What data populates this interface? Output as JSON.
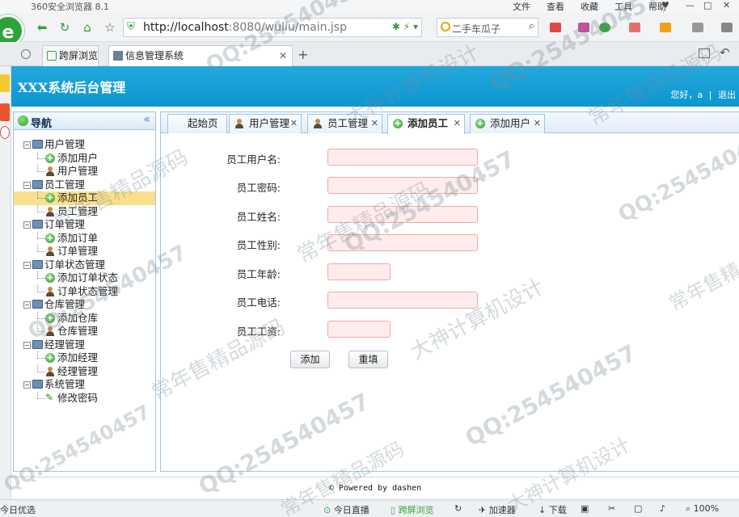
{
  "browser": {
    "app_title": "360安全浏览器 8.1",
    "menu": [
      "文件",
      "查看",
      "收藏",
      "工具",
      "帮助"
    ],
    "url_host": "http://localhost",
    "url_rest": ":8080/wuliu/main.jsp",
    "search_text": "二手车瓜子",
    "tabs": [
      {
        "label": "跨屏浏览"
      },
      {
        "label": "信息管理系统",
        "active": true
      }
    ]
  },
  "app": {
    "title": "XXX系统后台管理",
    "greeting": "您好，a",
    "logout": "退出"
  },
  "nav": {
    "title": "导航",
    "groups": [
      {
        "label": "用户管理",
        "children": [
          {
            "label": "添加用户",
            "icon": "add-icon"
          },
          {
            "label": "用户管理",
            "icon": "user-icon"
          }
        ]
      },
      {
        "label": "员工管理",
        "children": [
          {
            "label": "添加员工",
            "icon": "add-icon",
            "selected": true
          },
          {
            "label": "员工管理",
            "icon": "user-icon"
          }
        ]
      },
      {
        "label": "订单管理",
        "children": [
          {
            "label": "添加订单",
            "icon": "add-icon"
          },
          {
            "label": "订单管理",
            "icon": "user-icon"
          }
        ]
      },
      {
        "label": "订单状态管理",
        "children": [
          {
            "label": "添加订单状态",
            "icon": "add-icon"
          },
          {
            "label": "订单状态管理",
            "icon": "user-icon"
          }
        ]
      },
      {
        "label": "仓库管理",
        "children": [
          {
            "label": "添加仓库",
            "icon": "add-icon"
          },
          {
            "label": "仓库管理",
            "icon": "user-icon"
          }
        ]
      },
      {
        "label": "经理管理",
        "children": [
          {
            "label": "添加经理",
            "icon": "add-icon"
          },
          {
            "label": "经理管理",
            "icon": "user-icon"
          }
        ]
      },
      {
        "label": "系统管理",
        "children": [
          {
            "label": "修改密码",
            "icon": "pencil-icon"
          }
        ]
      }
    ]
  },
  "content_tabs": [
    {
      "label": "起始页",
      "icon": "",
      "closable": false
    },
    {
      "label": "用户管理",
      "icon": "user-icon",
      "closable": true
    },
    {
      "label": "员工管理",
      "icon": "user-icon",
      "closable": true
    },
    {
      "label": "添加员工",
      "icon": "add-icon",
      "closable": true,
      "active": true
    },
    {
      "label": "添加用户",
      "icon": "add-icon",
      "closable": true
    }
  ],
  "form": {
    "fields": [
      {
        "label": "员工用户名:",
        "value": "",
        "size": "long"
      },
      {
        "label": "员工密码:",
        "value": "",
        "size": "long"
      },
      {
        "label": "员工姓名:",
        "value": "",
        "size": "long"
      },
      {
        "label": "员工性别:",
        "value": "",
        "size": "long"
      },
      {
        "label": "员工年龄:",
        "value": "",
        "size": "short"
      },
      {
        "label": "员工电话:",
        "value": "",
        "size": "long"
      },
      {
        "label": "员工工资:",
        "value": "",
        "size": "short"
      }
    ],
    "submit_label": "添加",
    "reset_label": "重填"
  },
  "footer": {
    "powered": "© Powered by dashen"
  },
  "statusbar": {
    "left": "今日优选",
    "live": "今日直播",
    "cross": "跨屏浏览",
    "accelerator": "加速器",
    "download": "下载",
    "zoom": "100%"
  },
  "watermarks": [
    "QQ:254540457",
    "大神计算机设计",
    "常年售精品源码"
  ],
  "colors": {
    "header_blue": "#0c96d0",
    "input_pink": "#ffeced",
    "selected_yellow": "#fbdf8c"
  }
}
